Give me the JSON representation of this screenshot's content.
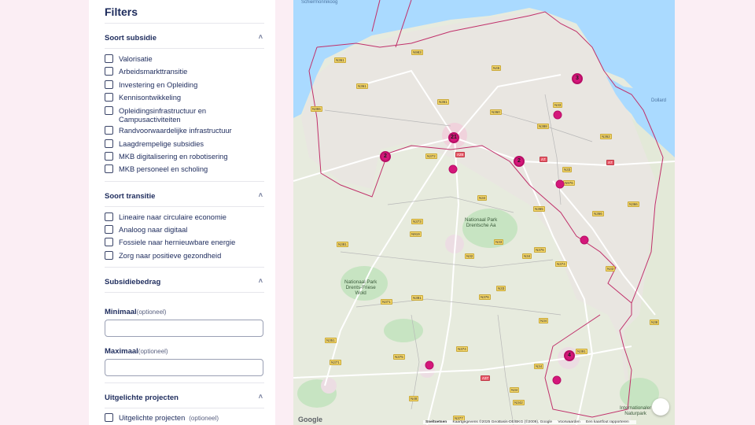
{
  "filters": {
    "title": "Filters",
    "soort_subsidie": {
      "label": "Soort subsidie",
      "options": [
        "Valorisatie",
        "Arbeidsmarkttransitie",
        "Investering en Opleiding",
        "Kennisontwikkeling",
        "Opleidingsinfrastructuur en Campusactiviteiten",
        "Randvoorwaardelijke infrastructuur",
        "Laagdrempelige subsidies",
        "MKB digitalisering en robotisering",
        "MKB personeel en scholing"
      ]
    },
    "soort_transitie": {
      "label": "Soort transitie",
      "options": [
        "Lineaire naar circulaire economie",
        "Analoog naar digitaal",
        "Fossiele naar hernieuwbare energie",
        "Zorg naar positieve gezondheid"
      ]
    },
    "subsidiebedrag": {
      "label": "Subsidiebedrag",
      "min_label": "Minimaal",
      "max_label": "Maximaal",
      "optional": "(optioneel)",
      "min_value": "",
      "max_value": ""
    },
    "uitgelichte": {
      "label": "Uitgelichte projecten",
      "option": "Uitgelichte projecten",
      "optional": "(optioneel)"
    }
  },
  "map": {
    "clusters": [
      "3",
      "21",
      "2",
      "2",
      "4"
    ],
    "places": {
      "schiermonnikoog": "Schiermonnikoog",
      "dollard": "Dollard",
      "drentsche_aa": "Nationaal Park\nDrentsche Aa",
      "drents_friese_wold": "Nationaal Park\nDrents-Friese\nWold",
      "naturpark": "Internationaler\nNaturpark"
    },
    "roads": [
      "N361",
      "N983",
      "N46",
      "N355",
      "N361",
      "N33",
      "N360",
      "N388",
      "N361",
      "A7",
      "N33",
      "N372",
      "A28",
      "N34",
      "N366",
      "N373",
      "N919",
      "N33",
      "N34",
      "N376",
      "N381",
      "N32",
      "N33",
      "N374",
      "N371",
      "N381",
      "N376",
      "N34",
      "N391",
      "N351",
      "N371",
      "N375",
      "N374",
      "N34",
      "A37",
      "N34",
      "N342",
      "N48",
      "N377",
      "N362",
      "A7",
      "N366",
      "N33",
      "N365",
      "N976",
      "N38"
    ],
    "footer": {
      "shortcuts": "Sneltoetsen",
      "mapdata": "Kaartgegevens ©2025 GeoBasis-DE/BKG (©2009), Google",
      "terms": "Voorwaarden",
      "report": "Een kaartfout rapporteren"
    },
    "google": "Google"
  },
  "colors": {
    "marker": "#d4177a",
    "water": "#aadaff",
    "land": "#e7ebde",
    "forest": "#bfe0c0",
    "province_border": "#c0306a"
  }
}
